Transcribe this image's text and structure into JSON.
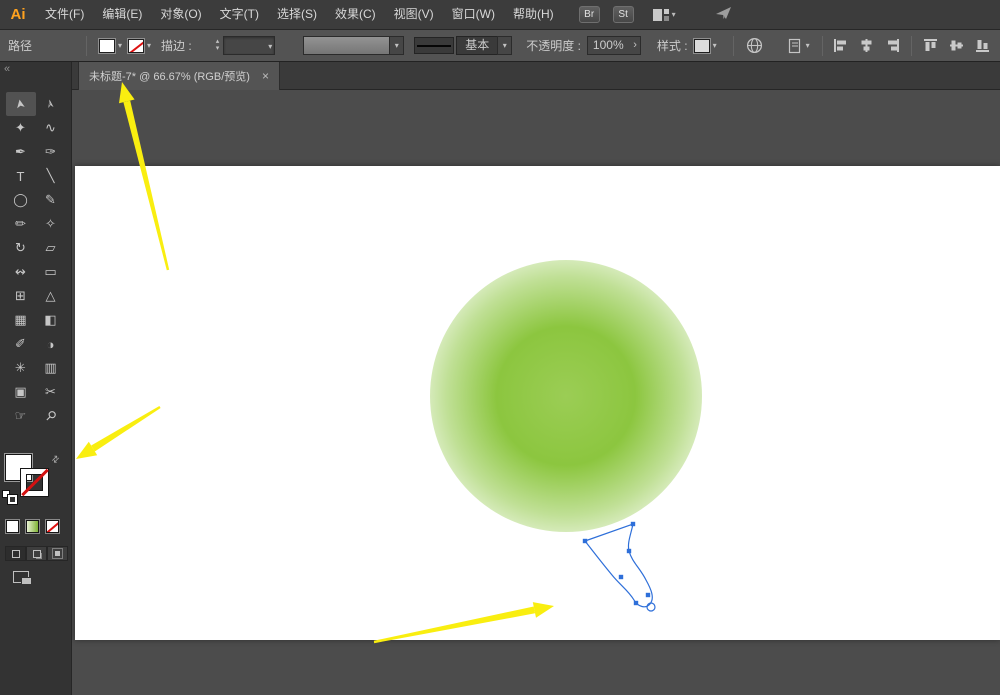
{
  "colors": {
    "menubar_bg": "#3c3c3c",
    "controlbar_bg": "#535353",
    "toolbar_bg": "#333333",
    "canvas_bg": "#4c4c4c",
    "artboard_bg": "#ffffff",
    "gradient_green": "#8cc63f",
    "selection_blue": "#2e6fd9",
    "annotation_yellow": "#f9ee10",
    "logo_orange": "#ffa21f",
    "stroke_none_red": "#dd1111"
  },
  "icons": {
    "chevron_down": "▾",
    "chevron_up": "▴",
    "chevron_right": "›",
    "swap": "⇄",
    "collapse": "«"
  },
  "menubar": {
    "logo": "Ai",
    "items": [
      {
        "name": "menu-file",
        "label": "文件(F)"
      },
      {
        "name": "menu-edit",
        "label": "编辑(E)"
      },
      {
        "name": "menu-object",
        "label": "对象(O)"
      },
      {
        "name": "menu-type",
        "label": "文字(T)"
      },
      {
        "name": "menu-select",
        "label": "选择(S)"
      },
      {
        "name": "menu-effect",
        "label": "效果(C)"
      },
      {
        "name": "menu-view",
        "label": "视图(V)"
      },
      {
        "name": "menu-window",
        "label": "窗口(W)"
      },
      {
        "name": "menu-help",
        "label": "帮助(H)"
      }
    ],
    "bridge_label": "Br",
    "stock_label": "St"
  },
  "controlbar": {
    "context_label": "路径",
    "stroke_label": "描边 :",
    "basic_label": "基本",
    "opacity_label": "不透明度 :",
    "opacity_value": "100%",
    "style_label": "样式 :"
  },
  "tabbar": {
    "active_tab_title": "未标题-7* @ 66.67% (RGB/预览)",
    "close_glyph": "×"
  },
  "toolbar": {
    "tools": [
      {
        "name": "selection-tool",
        "glyph": "➤",
        "cls": "cur",
        "active": true
      },
      {
        "name": "direct-selection-tool",
        "glyph": "➢",
        "cls": "cur"
      },
      {
        "name": "magic-wand-tool",
        "glyph": "✦"
      },
      {
        "name": "lasso-tool",
        "glyph": "∿"
      },
      {
        "name": "pen-tool",
        "glyph": "✒"
      },
      {
        "name": "curvature-tool",
        "glyph": "✑"
      },
      {
        "name": "type-tool",
        "glyph": "T"
      },
      {
        "name": "line-segment-tool",
        "glyph": "╲"
      },
      {
        "name": "ellipse-tool",
        "glyph": "◯"
      },
      {
        "name": "paintbrush-tool",
        "glyph": "✎"
      },
      {
        "name": "pencil-tool",
        "glyph": "✏"
      },
      {
        "name": "shaper-tool",
        "glyph": "✧"
      },
      {
        "name": "rotate-tool",
        "glyph": "↻"
      },
      {
        "name": "scale-tool",
        "glyph": "▱"
      },
      {
        "name": "width-tool",
        "glyph": "↭"
      },
      {
        "name": "free-transform-tool",
        "glyph": "▭"
      },
      {
        "name": "shape-builder-tool",
        "glyph": "⊞"
      },
      {
        "name": "perspective-grid-tool",
        "glyph": "△"
      },
      {
        "name": "mesh-tool",
        "glyph": "▦"
      },
      {
        "name": "gradient-tool",
        "glyph": "◧"
      },
      {
        "name": "eyedropper-tool",
        "glyph": "✐"
      },
      {
        "name": "blend-tool",
        "glyph": "◑"
      },
      {
        "name": "symbol-sprayer-tool",
        "glyph": "✳"
      },
      {
        "name": "column-graph-tool",
        "glyph": "▥"
      },
      {
        "name": "artboard-tool",
        "glyph": "▣"
      },
      {
        "name": "slice-tool",
        "glyph": "✂"
      },
      {
        "name": "hand-tool",
        "glyph": "☞"
      },
      {
        "name": "zoom-tool",
        "glyph": "⚲",
        "cls": "rot45"
      }
    ]
  },
  "annotations": {
    "arrows": [
      "arrow-to-tab",
      "arrow-to-fill-swatch",
      "arrow-to-path"
    ]
  }
}
